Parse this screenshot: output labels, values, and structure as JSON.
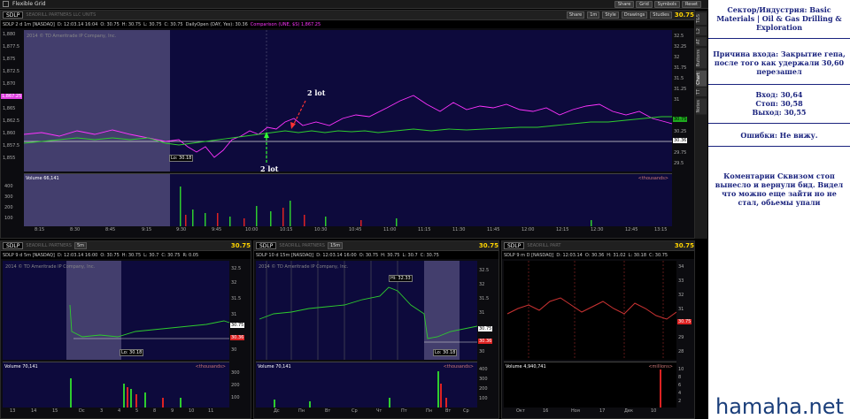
{
  "window": {
    "title": "Flexible Grid",
    "buttons": [
      "Share",
      "Grid",
      "Symbols",
      "Reset"
    ]
  },
  "main_chart": {
    "symbol": "SDLP",
    "company": "SEADRILL PARTNERS LLC UNITS",
    "header_buttons": [
      "Share",
      "1m",
      "Style",
      "Drawings",
      "Studies"
    ],
    "price": "30.75",
    "ohlc": [
      "SDLP 2 d 1m [NASDAQ]",
      "D: 12:03.14 16:04",
      "O: 30.75",
      "H: 30.75",
      "L: 30.75",
      "C: 30.75",
      "DailyOpen (DAY, Yes): 30.36"
    ],
    "comparison": "Comparison (UNE, $S) 1,867.25",
    "watermark": "2014 © TD Ameritrade IP Company, Inc.",
    "left_axis": [
      "1,880",
      "1,877.5",
      "1,875",
      "1,872.5",
      "1,870",
      "1,867.5",
      "1,865",
      "1,862.5",
      "1,860",
      "1,857.5",
      "1,855"
    ],
    "right_axis": [
      "32.5",
      "32.25",
      "32",
      "31.75",
      "31.5",
      "31.25",
      "31",
      "30.75",
      "30.5",
      "30.25",
      "30",
      "29.75",
      "29.5"
    ],
    "left_highlight": "1,867.25",
    "badge_green": "30.75",
    "badge_white": "30.36",
    "lo_label": "Lo: 30.18",
    "annotation_top": "2 lot",
    "annotation_bottom": "2 lot",
    "volume_label": "Volume",
    "volume_value": "66,141",
    "volume_units": "<thousands>",
    "volume_axis": [
      "400",
      "300",
      "200",
      "100"
    ],
    "x_axis": [
      "9:15",
      "9:30",
      "9:45",
      "10:00",
      "10:15",
      "10:30",
      "10:45",
      "11:00",
      "11:15",
      "11:30",
      "11:45",
      "12:00",
      "12:15",
      "12:30",
      "12:45",
      "13:00",
      "13:15"
    ],
    "x_axis_left": [
      "8:15",
      "8:30",
      "8:45"
    ],
    "side_tabs": [
      "T&S",
      "L2",
      "AT",
      "Buttons",
      "Chart",
      "TT",
      "Notes"
    ]
  },
  "bottom_charts": [
    {
      "symbol": "SDLP",
      "company": "SEADRILL PARTNERS",
      "interval": "5m",
      "price": "30.75",
      "ohlc": [
        "SDLP 9 d 5m [NASDAQ]",
        "D: 12:03.14 16:00",
        "O: 30.75",
        "H: 30.75",
        "L: 30.7",
        "C: 30.75",
        "R: 0.05"
      ],
      "watermark": "2014 © TD Ameritrade IP Company, Inc.",
      "right_axis": [
        "32.5",
        "32",
        "31.5",
        "31",
        "30.5",
        "30"
      ],
      "badge_white": "30.75",
      "badge_red": "30.36",
      "lo_label": "Lo: 30.18",
      "volume_value": "70,141",
      "volume_units": "<thousands>",
      "volume_axis": [
        "300",
        "200",
        "100"
      ],
      "x_axis": [
        "13",
        "14",
        "15",
        "Dc",
        "3",
        "4",
        "5",
        "8",
        "9",
        "10",
        "11"
      ]
    },
    {
      "symbol": "SDLP",
      "company": "SEADRILL PARTNERS",
      "interval": "15m",
      "price": "30.75",
      "ohlc": [
        "SDLP 10 d 15m [NASDAQ]",
        "D: 12:03.14 16:00",
        "O: 30.75",
        "H: 30.75",
        "L: 30.7",
        "C: 30.75"
      ],
      "watermark": "2014 © TD Ameritrade IP Company, Inc.",
      "right_axis": [
        "32.5",
        "32",
        "31.5",
        "31",
        "30.5",
        "30"
      ],
      "hi_label": "Hi: 32.33",
      "badge_white": "30.75",
      "badge_red": "30.36",
      "lo_label": "Lo: 30.18",
      "volume_value": "70,141",
      "volume_units": "<thousands>",
      "volume_axis": [
        "400",
        "300",
        "200",
        "100"
      ],
      "x_axis": [
        "Дс",
        "Пн",
        "Вт",
        "Ср",
        "Чт",
        "Пт",
        "Пн",
        "Вт",
        "Ср"
      ]
    },
    {
      "symbol": "SDLP",
      "company": "SEADRILL PART",
      "interval": "",
      "price": "30.75",
      "ohlc": [
        "SDLP 9 m D [NASDAQ]",
        "D: 12:03.14",
        "O: 30.36",
        "H: 31.02",
        "L: 30.18",
        "C: 30.75"
      ],
      "watermark": "",
      "right_axis": [
        "34",
        "33",
        "32",
        "31",
        "30",
        "29",
        "28"
      ],
      "badge_red": "30.75",
      "volume_value": "4,940,741",
      "volume_units": "<millions>",
      "volume_axis": [
        "10",
        "8",
        "6",
        "4",
        "2"
      ],
      "x_axis": [
        "Окт",
        "16",
        "Ноя",
        "17",
        "Дек",
        "10"
      ]
    }
  ],
  "notes": {
    "sector": "Сектор/Индустрия: Basic Materials | Oil & Gas Drilling & Exploration",
    "reason": "Причина входа: Закрытие гепа, после того как удержали 30,60 перезашел",
    "entry": "Вход: 30,64",
    "stop": "Стоп: 30,58",
    "exit": "Выход: 30,55",
    "errors": "Ошибки: Не вижу.",
    "comment": "Коментарии Сквизом стоп вынесло и вернули бид. Видел что можно еще зайти но не стал, обьемы упали",
    "brand": "hamaha.net"
  }
}
